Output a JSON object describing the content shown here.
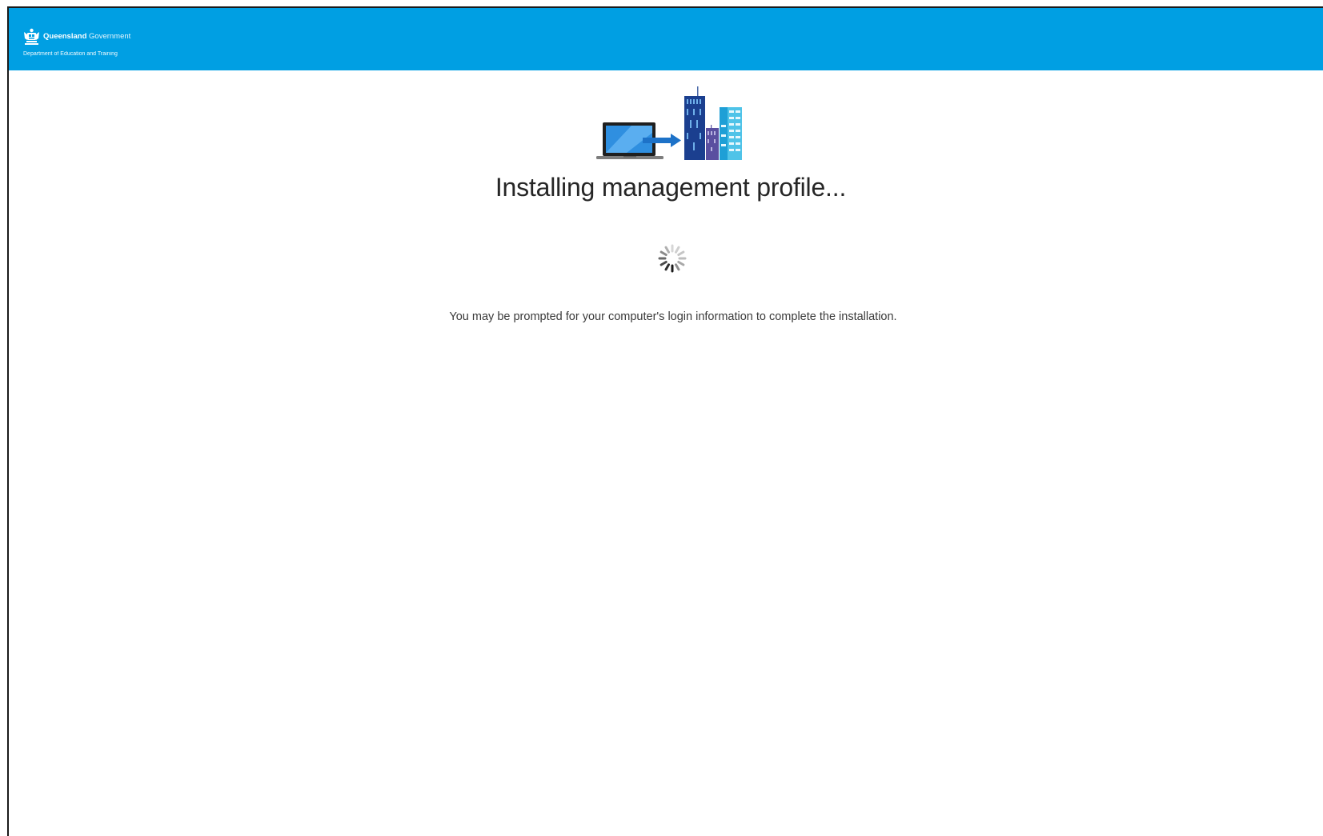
{
  "header": {
    "org_bold": "Queensland",
    "org_light": "Government",
    "department": "Department of Education and Training",
    "background_color": "#009fe3",
    "logo_icon": "queensland-crest-icon"
  },
  "main": {
    "illustration_icon": "laptop-to-office-buildings-icon",
    "title": "Installing management profile...",
    "spinner_icon": "loading-spinner-icon",
    "note": "You may be prompted for your computer's login information to complete the installation."
  }
}
